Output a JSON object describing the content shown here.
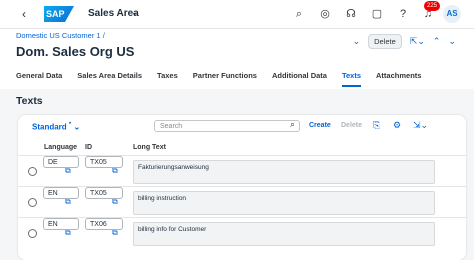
{
  "shell": {
    "logo": "SAP",
    "title": "Sales Area",
    "notification_count": "225",
    "avatar": "AS"
  },
  "header": {
    "breadcrumb": "Domestic US Customer 1 /",
    "title": "Dom. Sales Org US",
    "delete_label": "Delete",
    "tabs": [
      "General Data",
      "Sales Area Details",
      "Taxes",
      "Partner Functions",
      "Additional Data",
      "Texts",
      "Attachments"
    ],
    "active_tab": "Texts"
  },
  "section": {
    "title": "Texts"
  },
  "table": {
    "variant": "Standard",
    "variant_marker": "*",
    "search_placeholder": "Search",
    "create_label": "Create",
    "delete_label": "Delete",
    "columns": [
      "Language",
      "ID",
      "Long Text"
    ],
    "rows": [
      {
        "language": "DE",
        "id": "TX05",
        "long_text": "Fakturierungsanweisung"
      },
      {
        "language": "EN",
        "id": "TX05",
        "long_text": "billing instruction"
      },
      {
        "language": "EN",
        "id": "TX06",
        "long_text": "billing info for Customer"
      }
    ]
  },
  "colors": {
    "accent": "#0064d9",
    "badge": "#e00000"
  }
}
